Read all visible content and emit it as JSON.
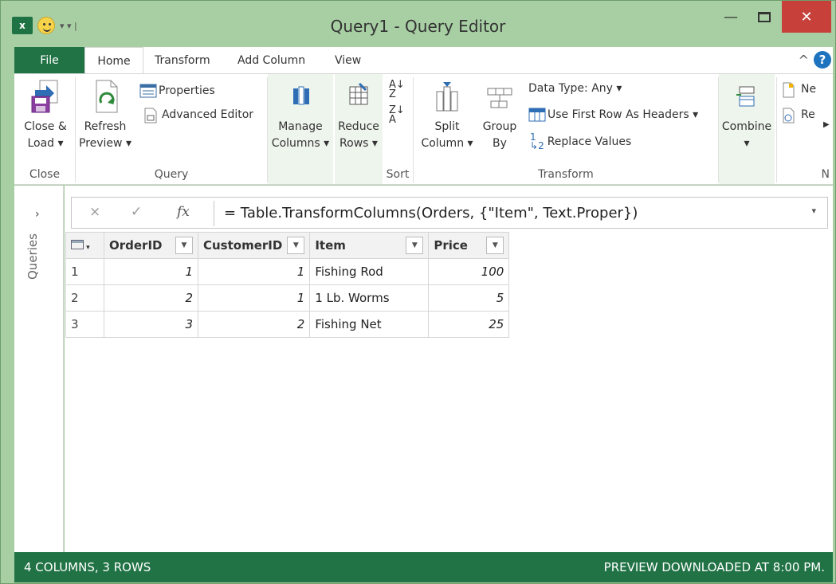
{
  "window": {
    "title": "Query1 - Query Editor",
    "minimize_label": "—",
    "close_label": "✕"
  },
  "qat": {
    "app_label": "x",
    "dropdown_mark": "▾ ▾ |"
  },
  "tabs": {
    "file": "File",
    "items": [
      "Home",
      "Transform",
      "Add Column",
      "View"
    ],
    "active": "Home",
    "collapse_icon": "^",
    "help_icon": "?"
  },
  "ribbon": {
    "groups": {
      "close": {
        "label": "Close",
        "close_load": [
          "Close &",
          "Load ▾"
        ]
      },
      "query": {
        "label": "Query",
        "refresh": [
          "Refresh",
          "Preview ▾"
        ],
        "properties": "Properties",
        "advanced_editor": "Advanced Editor"
      },
      "manage": {
        "manage_columns": [
          "Manage",
          "Columns ▾"
        ],
        "reduce_rows": [
          "Reduce",
          "Rows ▾"
        ]
      },
      "sort": {
        "label": "Sort"
      },
      "transform": {
        "label": "Transform",
        "split_column": [
          "Split",
          "Column ▾"
        ],
        "group_by": [
          "Group",
          "By"
        ],
        "data_type": "Data Type: Any ▾",
        "first_row_headers": "Use First Row As Headers ▾",
        "replace_values": "Replace Values",
        "replace_prefix": "1",
        "replace_suffix": "2"
      },
      "combine": {
        "combine": [
          "Combine",
          "▾"
        ]
      },
      "new_query": {
        "label": "N",
        "new_source": "Ne",
        "recent_sources": "Re"
      }
    }
  },
  "queries_pane": {
    "label": "Queries",
    "expand_icon": "›"
  },
  "formula_bar": {
    "cancel_icon": "×",
    "commit_icon": "✓",
    "fx_label": "fx",
    "formula": "= Table.TransformColumns(Orders, {\"Item\", Text.Proper})",
    "expand_icon": "▾"
  },
  "grid": {
    "columns": [
      "OrderID",
      "CustomerID",
      "Item",
      "Price"
    ],
    "rows": [
      {
        "n": "1",
        "OrderID": "1",
        "CustomerID": "1",
        "Item": "Fishing Rod",
        "Price": "100"
      },
      {
        "n": "2",
        "OrderID": "2",
        "CustomerID": "1",
        "Item": "1 Lb. Worms",
        "Price": "5"
      },
      {
        "n": "3",
        "OrderID": "3",
        "CustomerID": "2",
        "Item": "Fishing Net",
        "Price": "25"
      }
    ]
  },
  "status": {
    "left": "4 COLUMNS, 3 ROWS",
    "right": "PREVIEW DOWNLOADED AT 8:00 PM."
  },
  "colors": {
    "title_bar": "#a7cfa3",
    "excel_green": "#217346",
    "close_red": "#c7403a"
  }
}
